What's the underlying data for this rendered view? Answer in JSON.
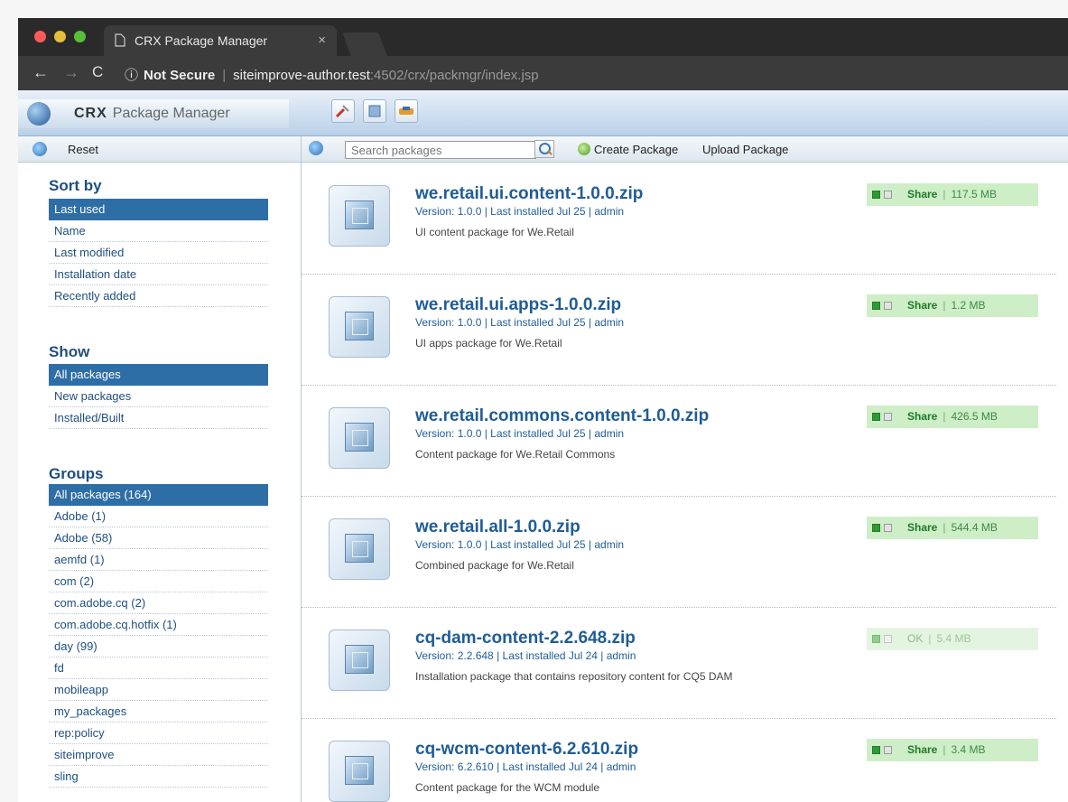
{
  "browser": {
    "tab_title": "CRX Package Manager",
    "tab_close": "×",
    "not_secure": "Not Secure",
    "url_host": "siteimprove-author.test",
    "url_path": ":4502/crx/packmgr/index.jsp",
    "traffic_colors": [
      "#fc5b57",
      "#e5bf3c",
      "#57c038"
    ]
  },
  "header": {
    "brand_bold": "CRX",
    "brand_text": "Package Manager"
  },
  "left": {
    "reset_label": "Reset",
    "sort_title": "Sort by",
    "sort_items": [
      "Last used",
      "Name",
      "Last modified",
      "Installation date",
      "Recently added"
    ],
    "show_title": "Show",
    "show_items": [
      "All packages",
      "New packages",
      "Installed/Built"
    ],
    "groups_title": "Groups",
    "group_items": [
      "All packages (164)",
      "Adobe (1)",
      "Adobe (58)",
      "aemfd (1)",
      "com (2)",
      "com.adobe.cq (2)",
      "com.adobe.cq.hotfix (1)",
      "day (99)",
      "fd",
      "mobileapp",
      "my_packages",
      "rep:policy",
      "siteimprove",
      "sling"
    ]
  },
  "toolbar": {
    "search_placeholder": "Search packages",
    "create_label": "Create Package",
    "upload_label": "Upload Package"
  },
  "packages": [
    {
      "name": "we.retail.ui.content-1.0.0.zip",
      "version": "Version: 1.0.0 | Last installed Jul 25 | admin",
      "desc": "UI content package for We.Retail",
      "status": "Share",
      "size": "117.5 MB",
      "ok": false
    },
    {
      "name": "we.retail.ui.apps-1.0.0.zip",
      "version": "Version: 1.0.0 | Last installed Jul 25 | admin",
      "desc": "UI apps package for We.Retail",
      "status": "Share",
      "size": "1.2 MB",
      "ok": false
    },
    {
      "name": "we.retail.commons.content-1.0.0.zip",
      "version": "Version: 1.0.0 | Last installed Jul 25 | admin",
      "desc": "Content package for We.Retail Commons",
      "status": "Share",
      "size": "426.5 MB",
      "ok": false
    },
    {
      "name": "we.retail.all-1.0.0.zip",
      "version": "Version: 1.0.0 | Last installed Jul 25 | admin",
      "desc": "Combined package for We.Retail",
      "status": "Share",
      "size": "544.4 MB",
      "ok": false
    },
    {
      "name": "cq-dam-content-2.2.648.zip",
      "version": "Version: 2.2.648 | Last installed Jul 24 | admin",
      "desc": "Installation package that contains repository content for CQ5 DAM",
      "status": "OK",
      "size": "5.4 MB",
      "ok": true
    },
    {
      "name": "cq-wcm-content-6.2.610.zip",
      "version": "Version: 6.2.610 | Last installed Jul 24 | admin",
      "desc": "Content package for the WCM module",
      "status": "Share",
      "size": "3.4 MB",
      "ok": false
    }
  ]
}
